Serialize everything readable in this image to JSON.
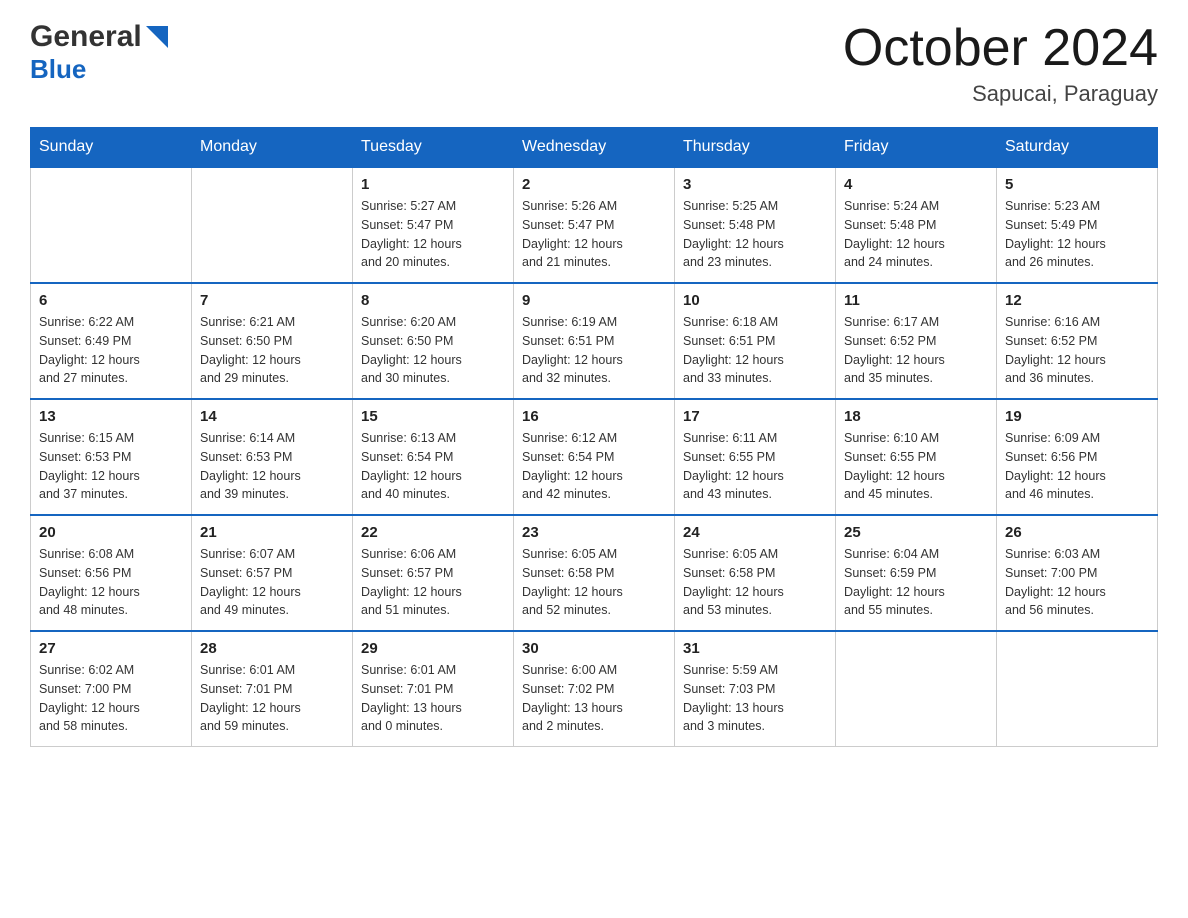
{
  "logo": {
    "general": "General",
    "blue": "Blue"
  },
  "title": {
    "month": "October 2024",
    "location": "Sapucai, Paraguay"
  },
  "weekdays": [
    "Sunday",
    "Monday",
    "Tuesday",
    "Wednesday",
    "Thursday",
    "Friday",
    "Saturday"
  ],
  "weeks": [
    [
      {
        "day": "",
        "info": ""
      },
      {
        "day": "",
        "info": ""
      },
      {
        "day": "1",
        "sunrise": "5:27 AM",
        "sunset": "5:47 PM",
        "daylight": "12 hours and 20 minutes."
      },
      {
        "day": "2",
        "sunrise": "5:26 AM",
        "sunset": "5:47 PM",
        "daylight": "12 hours and 21 minutes."
      },
      {
        "day": "3",
        "sunrise": "5:25 AM",
        "sunset": "5:48 PM",
        "daylight": "12 hours and 23 minutes."
      },
      {
        "day": "4",
        "sunrise": "5:24 AM",
        "sunset": "5:48 PM",
        "daylight": "12 hours and 24 minutes."
      },
      {
        "day": "5",
        "sunrise": "5:23 AM",
        "sunset": "5:49 PM",
        "daylight": "12 hours and 26 minutes."
      }
    ],
    [
      {
        "day": "6",
        "sunrise": "6:22 AM",
        "sunset": "6:49 PM",
        "daylight": "12 hours and 27 minutes."
      },
      {
        "day": "7",
        "sunrise": "6:21 AM",
        "sunset": "6:50 PM",
        "daylight": "12 hours and 29 minutes."
      },
      {
        "day": "8",
        "sunrise": "6:20 AM",
        "sunset": "6:50 PM",
        "daylight": "12 hours and 30 minutes."
      },
      {
        "day": "9",
        "sunrise": "6:19 AM",
        "sunset": "6:51 PM",
        "daylight": "12 hours and 32 minutes."
      },
      {
        "day": "10",
        "sunrise": "6:18 AM",
        "sunset": "6:51 PM",
        "daylight": "12 hours and 33 minutes."
      },
      {
        "day": "11",
        "sunrise": "6:17 AM",
        "sunset": "6:52 PM",
        "daylight": "12 hours and 35 minutes."
      },
      {
        "day": "12",
        "sunrise": "6:16 AM",
        "sunset": "6:52 PM",
        "daylight": "12 hours and 36 minutes."
      }
    ],
    [
      {
        "day": "13",
        "sunrise": "6:15 AM",
        "sunset": "6:53 PM",
        "daylight": "12 hours and 37 minutes."
      },
      {
        "day": "14",
        "sunrise": "6:14 AM",
        "sunset": "6:53 PM",
        "daylight": "12 hours and 39 minutes."
      },
      {
        "day": "15",
        "sunrise": "6:13 AM",
        "sunset": "6:54 PM",
        "daylight": "12 hours and 40 minutes."
      },
      {
        "day": "16",
        "sunrise": "6:12 AM",
        "sunset": "6:54 PM",
        "daylight": "12 hours and 42 minutes."
      },
      {
        "day": "17",
        "sunrise": "6:11 AM",
        "sunset": "6:55 PM",
        "daylight": "12 hours and 43 minutes."
      },
      {
        "day": "18",
        "sunrise": "6:10 AM",
        "sunset": "6:55 PM",
        "daylight": "12 hours and 45 minutes."
      },
      {
        "day": "19",
        "sunrise": "6:09 AM",
        "sunset": "6:56 PM",
        "daylight": "12 hours and 46 minutes."
      }
    ],
    [
      {
        "day": "20",
        "sunrise": "6:08 AM",
        "sunset": "6:56 PM",
        "daylight": "12 hours and 48 minutes."
      },
      {
        "day": "21",
        "sunrise": "6:07 AM",
        "sunset": "6:57 PM",
        "daylight": "12 hours and 49 minutes."
      },
      {
        "day": "22",
        "sunrise": "6:06 AM",
        "sunset": "6:57 PM",
        "daylight": "12 hours and 51 minutes."
      },
      {
        "day": "23",
        "sunrise": "6:05 AM",
        "sunset": "6:58 PM",
        "daylight": "12 hours and 52 minutes."
      },
      {
        "day": "24",
        "sunrise": "6:05 AM",
        "sunset": "6:58 PM",
        "daylight": "12 hours and 53 minutes."
      },
      {
        "day": "25",
        "sunrise": "6:04 AM",
        "sunset": "6:59 PM",
        "daylight": "12 hours and 55 minutes."
      },
      {
        "day": "26",
        "sunrise": "6:03 AM",
        "sunset": "7:00 PM",
        "daylight": "12 hours and 56 minutes."
      }
    ],
    [
      {
        "day": "27",
        "sunrise": "6:02 AM",
        "sunset": "7:00 PM",
        "daylight": "12 hours and 58 minutes."
      },
      {
        "day": "28",
        "sunrise": "6:01 AM",
        "sunset": "7:01 PM",
        "daylight": "12 hours and 59 minutes."
      },
      {
        "day": "29",
        "sunrise": "6:01 AM",
        "sunset": "7:01 PM",
        "daylight": "13 hours and 0 minutes."
      },
      {
        "day": "30",
        "sunrise": "6:00 AM",
        "sunset": "7:02 PM",
        "daylight": "13 hours and 2 minutes."
      },
      {
        "day": "31",
        "sunrise": "5:59 AM",
        "sunset": "7:03 PM",
        "daylight": "13 hours and 3 minutes."
      },
      {
        "day": "",
        "info": ""
      },
      {
        "day": "",
        "info": ""
      }
    ]
  ],
  "labels": {
    "sunrise": "Sunrise:",
    "sunset": "Sunset:",
    "daylight": "Daylight:"
  }
}
